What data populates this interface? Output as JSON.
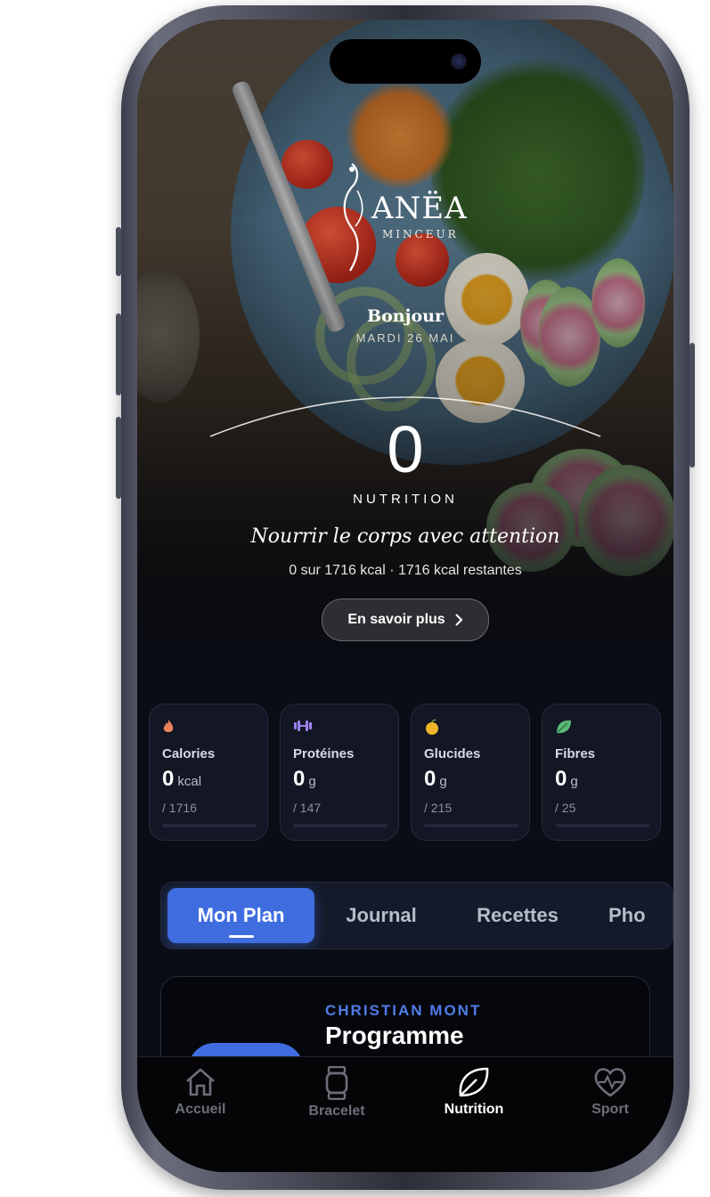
{
  "app": {
    "brand": "ANËA",
    "brand_sub": "MINCEUR",
    "greeting": "Bonjour",
    "date": "MARDI 26 MAI"
  },
  "hero": {
    "value": "0",
    "label": "NUTRITION",
    "tagline": "Nourrir le corps avec attention",
    "summary": "0 sur 1716 kcal · 1716 kcal restantes",
    "more_button": "En savoir plus"
  },
  "cards": [
    {
      "name": "Calories",
      "value": "0",
      "unit": "kcal",
      "goal": "/ 1716",
      "icon": "flame-icon",
      "color": "#e8825c"
    },
    {
      "name": "Protéines",
      "value": "0",
      "unit": "g",
      "goal": "/ 147",
      "icon": "dumbbell-icon",
      "color": "#9d83f0"
    },
    {
      "name": "Glucides",
      "value": "0",
      "unit": "g",
      "goal": "/ 215",
      "icon": "apple-icon",
      "color": "#f0b429"
    },
    {
      "name": "Fibres",
      "value": "0",
      "unit": "g",
      "goal": "/ 25",
      "icon": "leaf-icon",
      "color": "#5bb978"
    }
  ],
  "tabs": [
    {
      "label": "Mon Plan",
      "active": true
    },
    {
      "label": "Journal",
      "active": false
    },
    {
      "label": "Recettes",
      "active": false
    },
    {
      "label": "Pho",
      "active": false
    }
  ],
  "program": {
    "coach": "CHRISTIAN MONT",
    "title": "Programme"
  },
  "nav": [
    {
      "label": "Accueil",
      "icon": "home-icon",
      "active": false
    },
    {
      "label": "Bracelet",
      "icon": "watch-icon",
      "active": false
    },
    {
      "label": "Nutrition",
      "icon": "leaf-icon",
      "active": true
    },
    {
      "label": "Sport",
      "icon": "heart-pulse-icon",
      "active": false
    }
  ],
  "colors": {
    "accent": "#3f6de0",
    "background": "#0b0d16"
  }
}
